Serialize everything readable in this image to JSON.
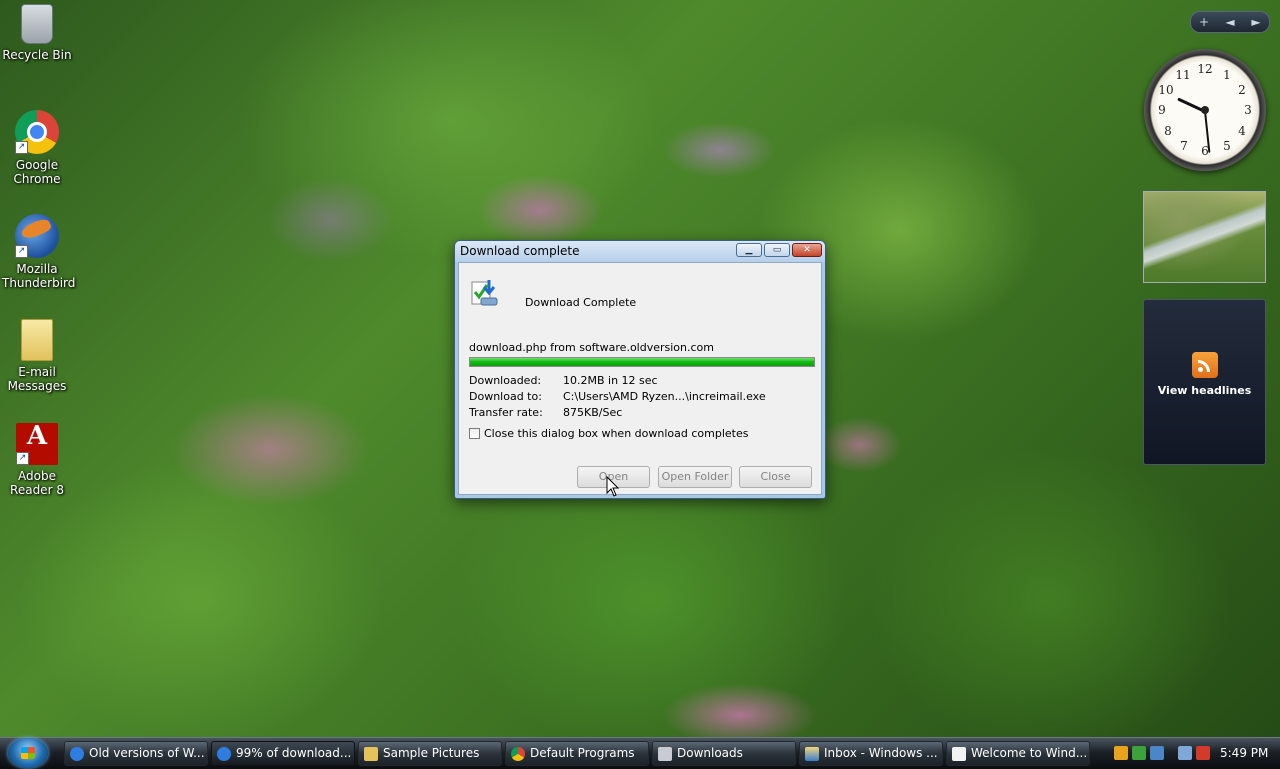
{
  "desktop": {
    "icons": [
      {
        "label": "Recycle Bin",
        "icon": "recycle-bin-icon"
      },
      {
        "label": "Google Chrome",
        "icon": "chrome-icon"
      },
      {
        "label": "Mozilla Thunderbird",
        "icon": "thunderbird-icon"
      },
      {
        "label": "E-mail Messages",
        "icon": "email-folder-icon"
      },
      {
        "label": "Adobe Reader 8",
        "icon": "pdf-icon"
      }
    ]
  },
  "sidebar": {
    "controls": [
      "+",
      "◄",
      "►"
    ],
    "clock_numbers": [
      "12",
      "1",
      "2",
      "3",
      "4",
      "5",
      "6",
      "7",
      "8",
      "9",
      "10",
      "11"
    ],
    "feed_label": "View headlines"
  },
  "dialog": {
    "title": "Download complete",
    "heading": "Download Complete",
    "source": "download.php from software.oldversion.com",
    "progress_fraction": 1.0,
    "rows": [
      {
        "key": "Downloaded:",
        "value": "10.2MB in 12 sec"
      },
      {
        "key": "Download to:",
        "value": "C:\\Users\\AMD Ryzen...\\increimail.exe"
      },
      {
        "key": "Transfer rate:",
        "value": "875KB/Sec"
      }
    ],
    "checkbox_label": "Close this dialog box when download completes",
    "checkbox_checked": false,
    "buttons": {
      "open": "Open",
      "open_folder": "Open Folder",
      "close": "Close"
    }
  },
  "taskbar": {
    "tasks": [
      {
        "label": "Old versions of W...",
        "icon": "ie-icon",
        "active": false
      },
      {
        "label": "99% of download...",
        "icon": "ie-icon",
        "active": true
      },
      {
        "label": "Sample Pictures",
        "icon": "folder-icon",
        "active": false
      },
      {
        "label": "Default Programs",
        "icon": "chrome-icon",
        "active": false
      },
      {
        "label": "Downloads",
        "icon": "folder-icon",
        "active": false
      },
      {
        "label": "Inbox - Windows ...",
        "icon": "mail-icon",
        "active": false
      },
      {
        "label": "Welcome to Wind...",
        "icon": "envelope-icon",
        "active": false
      }
    ],
    "time": "5:49 PM"
  },
  "colors": {
    "progress": "#14b814",
    "titlebar": "#b6cfea",
    "close_button": "#c4432a"
  }
}
